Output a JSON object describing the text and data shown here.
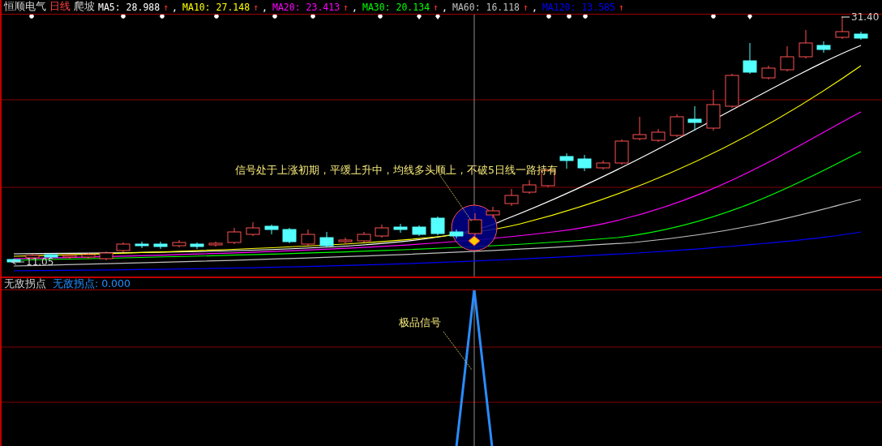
{
  "header": {
    "stock_name": "恒顺电气",
    "period": "日线",
    "formula": "爬坡",
    "ma_readings": [
      {
        "label": "MA5: 28.988",
        "arrow": "↑",
        "separator": ",",
        "color": "#ffffff"
      },
      {
        "label": "MA10: 27.148",
        "arrow": "↑",
        "separator": ",",
        "color": "#ffff00"
      },
      {
        "label": "MA20: 23.413",
        "arrow": "↑",
        "separator": ",",
        "color": "#ff00ff"
      },
      {
        "label": "MA30: 20.134",
        "arrow": "↑",
        "separator": ",",
        "color": "#00ff00"
      },
      {
        "label": "MA60: 16.118",
        "arrow": "↑",
        "separator": ",",
        "color": "#c0c0c0"
      },
      {
        "label": "MA120: 13.585",
        "arrow": "↑",
        "color": "#0000ff"
      }
    ]
  },
  "price_chart": {
    "max_label": "31.40",
    "min_label": "11.05",
    "annotation": "信号处于上涨初期，平缓上升中，均线多头顺上，不破5日线一路持有"
  },
  "indicator": {
    "name": "无敌拐点",
    "reading": "无敌拐点: 0.000",
    "annotation": "极品信号"
  }
}
